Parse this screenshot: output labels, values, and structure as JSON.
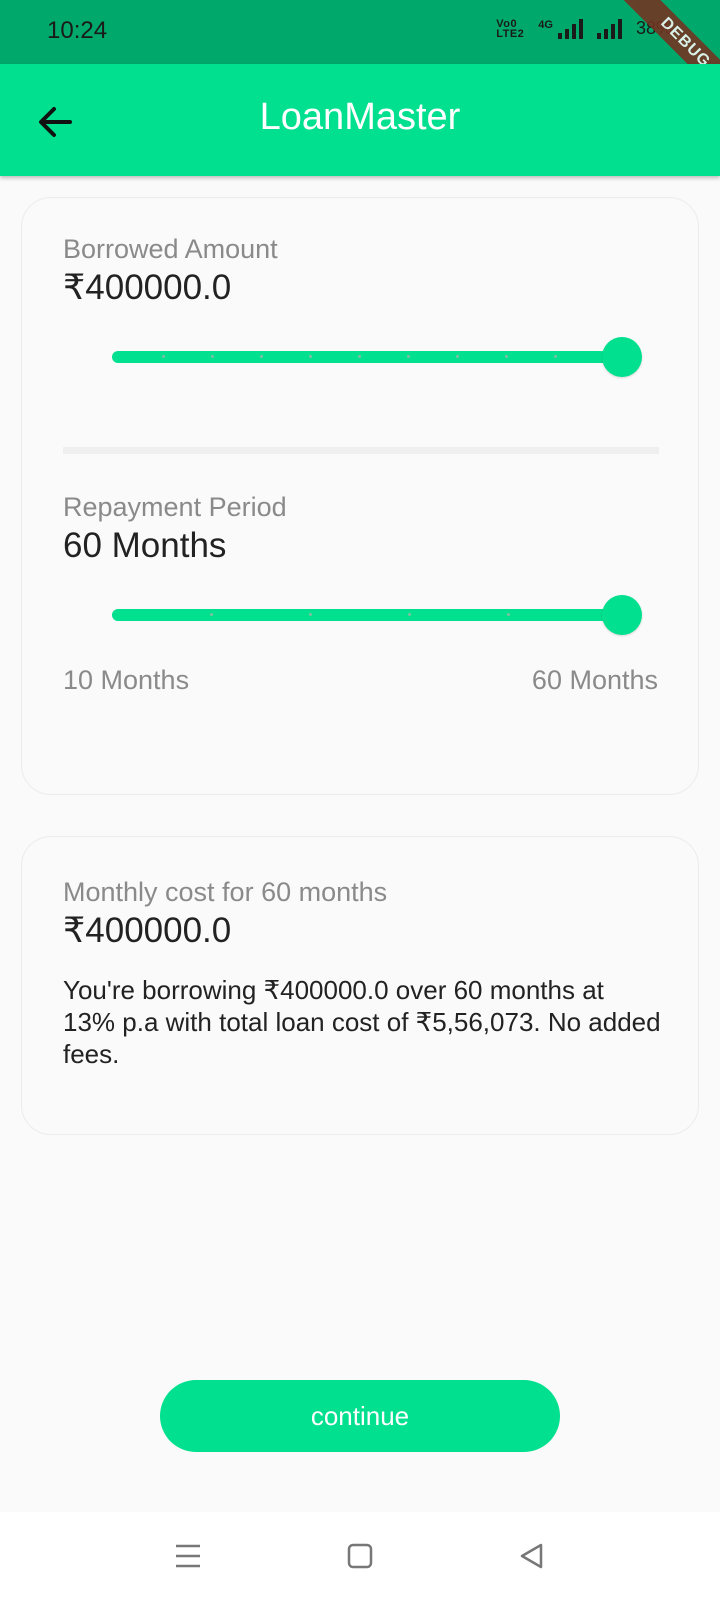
{
  "status_bar": {
    "time": "10:24",
    "volte_label_top": "Vo0",
    "volte_label_bottom": "LTE2",
    "network_label": "4G",
    "battery": "38%",
    "debug_label": "DEBUG"
  },
  "app_bar": {
    "title": "LoanMaster",
    "back_icon": "arrow-back-icon"
  },
  "borrow_card": {
    "amount_label": "Borrowed Amount",
    "amount_value": "₹400000.0",
    "amount_slider_fraction": 1.0,
    "period_label": "Repayment Period",
    "period_value": "60 Months",
    "period_slider_fraction": 1.0,
    "period_min": "10 Months",
    "period_max": "60 Months"
  },
  "cost_card": {
    "monthly_label": "Monthly cost for 60 months",
    "monthly_value": "₹400000.0",
    "summary": "You're borrowing ₹400000.0 over 60 months at 13% p.a with total loan cost of ₹5,56,073. No added fees."
  },
  "continue_button": {
    "label": "continue"
  },
  "nav_bar": {
    "icons": [
      "menu-icon",
      "home-square-icon",
      "back-triangle-icon"
    ]
  },
  "colors": {
    "accent": "#00e08e",
    "status_bar": "#00a86b"
  }
}
